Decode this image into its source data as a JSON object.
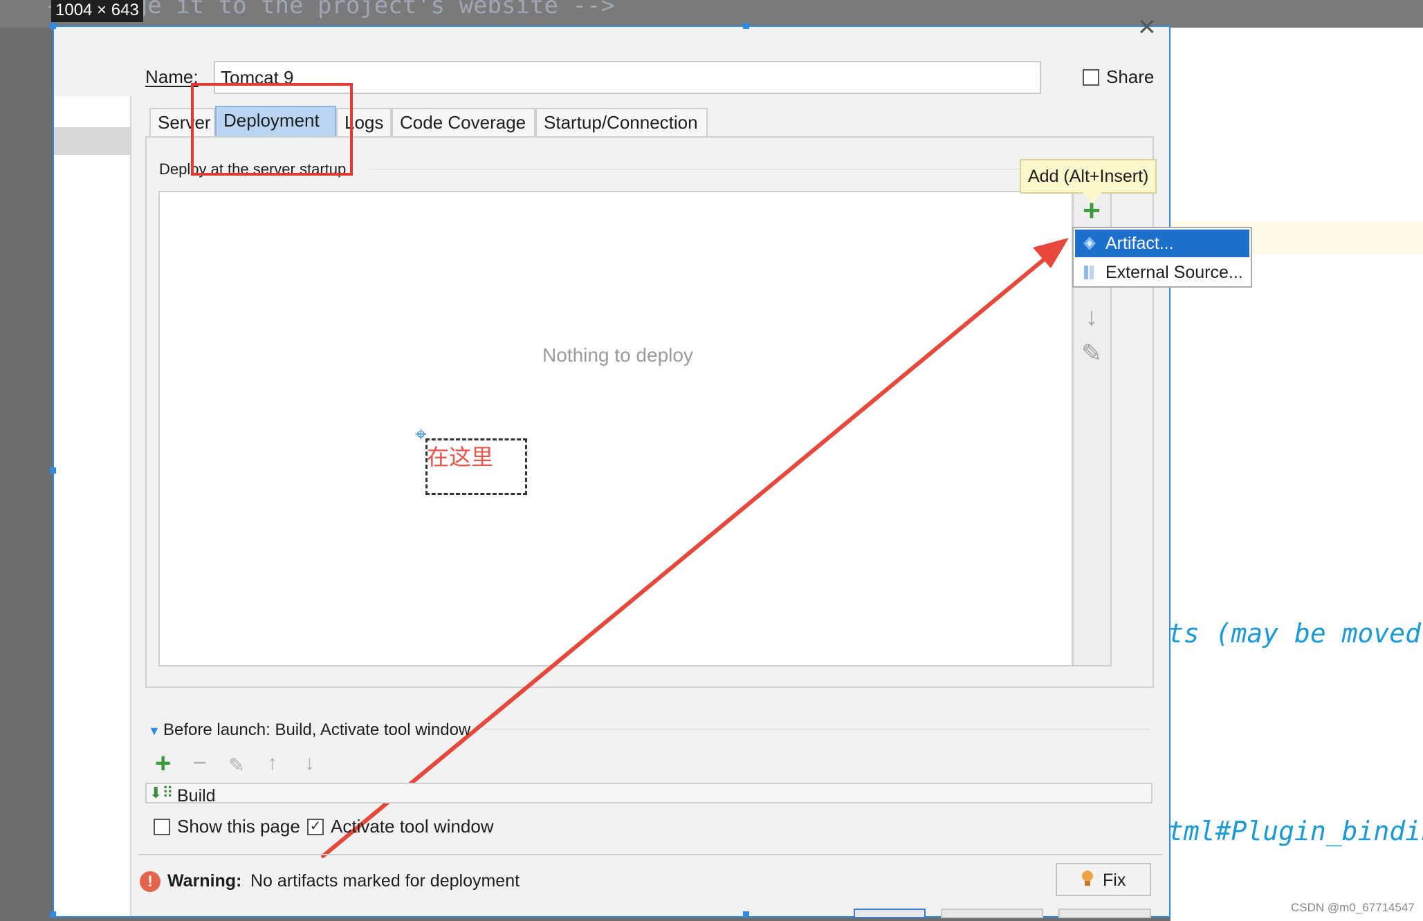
{
  "window": {
    "size_badge": "1004 × 643",
    "background_code_top": "— Change it to the project's website -->",
    "background_code_line1": "ts (may be moved t",
    "background_code_line2": "tml#Plugin_bindin",
    "watermark": "CSDN @m0_67714547",
    "accent_color": "#2f8ae0"
  },
  "dialog": {
    "name_label": "Name:",
    "name_value": "Tomcat 9",
    "share_label": "Share",
    "share_checked": false,
    "tabs": [
      {
        "label": "Server",
        "active": false
      },
      {
        "label": "Deployment",
        "active": true
      },
      {
        "label": "Logs",
        "active": false
      },
      {
        "label": "Code Coverage",
        "active": false
      },
      {
        "label": "Startup/Connection",
        "active": false
      }
    ],
    "deploy_caption": "Deploy at the server startup",
    "empty_text": "Nothing to deploy",
    "tooltip": "Add (Alt+Insert)",
    "popup_menu": [
      {
        "label": "Artifact...",
        "icon": "artifact-icon",
        "selected": true
      },
      {
        "label": "External Source...",
        "icon": "external-source-icon",
        "selected": false
      }
    ],
    "annotation_text": "在这里",
    "before_launch": {
      "label": "Before launch: Build, Activate tool window",
      "build_item": "Build",
      "show_page_label": "Show this page",
      "show_page_checked": false,
      "activate_label": "Activate tool window",
      "activate_checked": true
    },
    "warning": {
      "title": "Warning:",
      "message": "No artifacts marked for deployment",
      "color": "#e4644c"
    },
    "fix_label": "Fix",
    "highlight_color": "#e33a35"
  }
}
